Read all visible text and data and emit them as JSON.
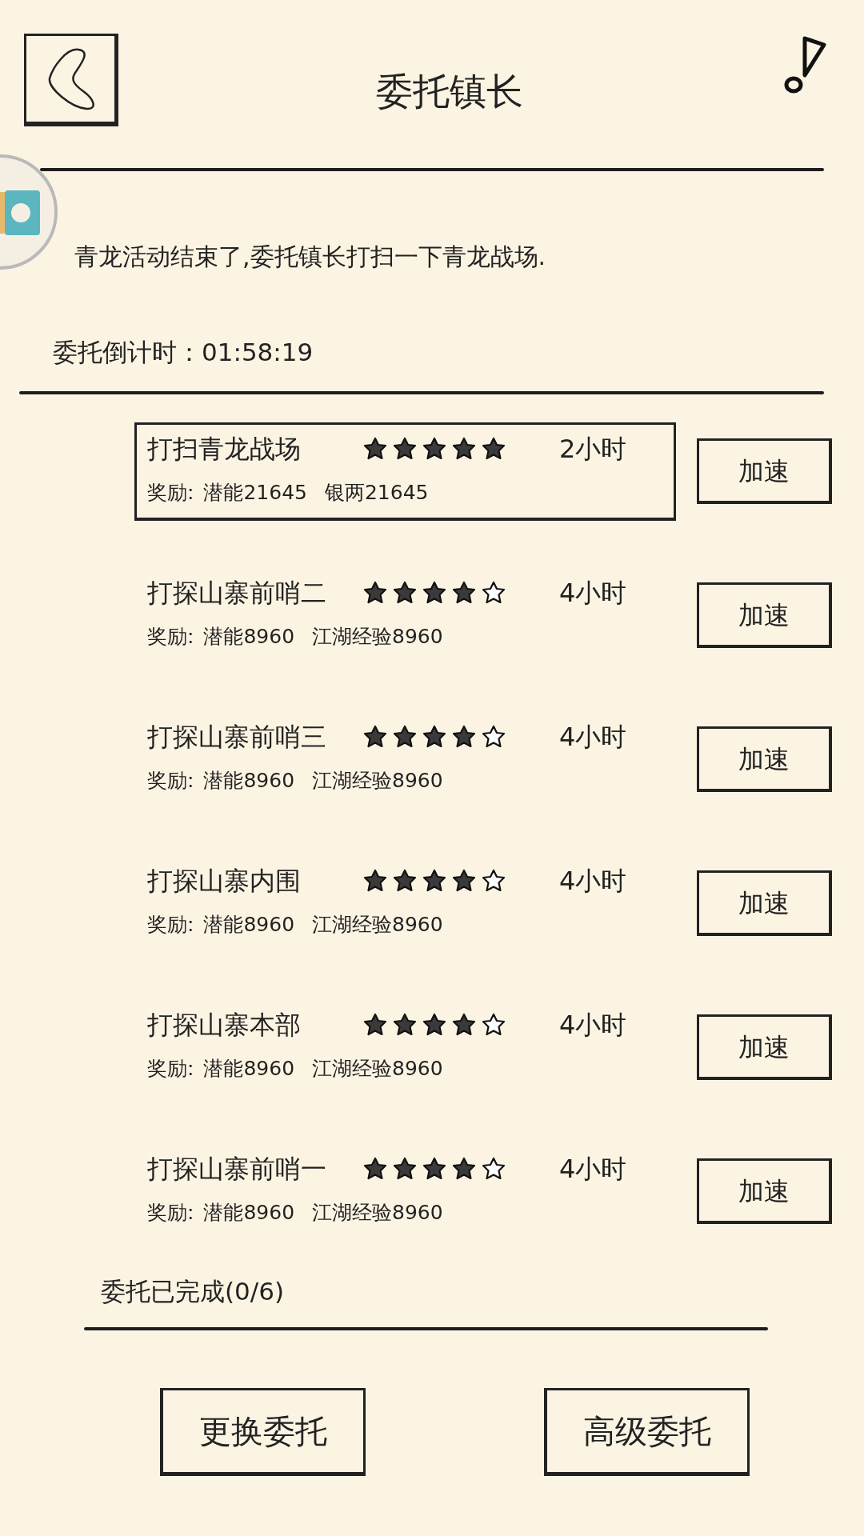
{
  "header": {
    "title": "委托镇长"
  },
  "description": "青龙活动结束了,委托镇长打扫一下青龙战场.",
  "countdown": {
    "label": "委托倒计时：",
    "value": "01:58:19"
  },
  "tasks": [
    {
      "name": "打扫青龙战场",
      "stars": 5,
      "duration": "2小时",
      "reward_label": "奖励:",
      "rewards": [
        "潜能21645",
        "银两21645"
      ],
      "button": "加速",
      "selected": true
    },
    {
      "name": "打探山寨前哨二",
      "stars": 4,
      "duration": "4小时",
      "reward_label": "奖励:",
      "rewards": [
        "潜能8960",
        "江湖经验8960"
      ],
      "button": "加速",
      "selected": false
    },
    {
      "name": "打探山寨前哨三",
      "stars": 4,
      "duration": "4小时",
      "reward_label": "奖励:",
      "rewards": [
        "潜能8960",
        "江湖经验8960"
      ],
      "button": "加速",
      "selected": false
    },
    {
      "name": "打探山寨内围",
      "stars": 4,
      "duration": "4小时",
      "reward_label": "奖励:",
      "rewards": [
        "潜能8960",
        "江湖经验8960"
      ],
      "button": "加速",
      "selected": false
    },
    {
      "name": "打探山寨本部",
      "stars": 4,
      "duration": "4小时",
      "reward_label": "奖励:",
      "rewards": [
        "潜能8960",
        "江湖经验8960"
      ],
      "button": "加速",
      "selected": false
    },
    {
      "name": "打探山寨前哨一",
      "stars": 4,
      "duration": "4小时",
      "reward_label": "奖励:",
      "rewards": [
        "潜能8960",
        "江湖经验8960"
      ],
      "button": "加速",
      "selected": false
    }
  ],
  "completed": "委托已完成(0/6)",
  "buttons": [
    "更换委托",
    "高级委托"
  ]
}
